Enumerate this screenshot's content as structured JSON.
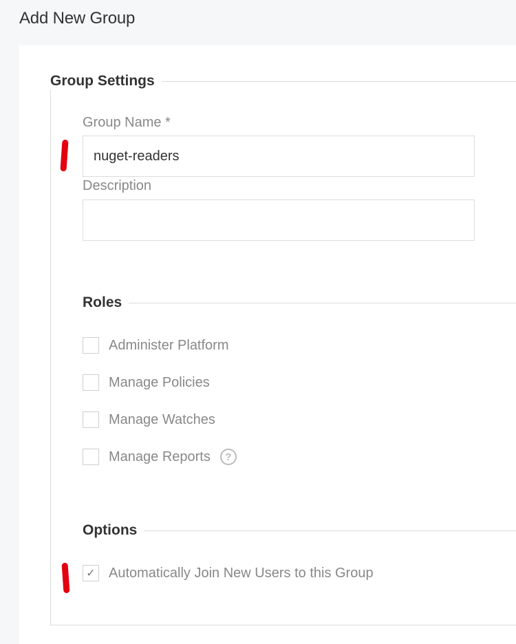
{
  "page": {
    "title": "Add New Group"
  },
  "group_settings": {
    "legend": "Group Settings",
    "group_name": {
      "label": "Group Name *",
      "value": "nuget-readers"
    },
    "description": {
      "label": "Description",
      "value": ""
    }
  },
  "roles": {
    "legend": "Roles",
    "items": [
      {
        "label": "Administer Platform",
        "checked": false
      },
      {
        "label": "Manage Policies",
        "checked": false
      },
      {
        "label": "Manage Watches",
        "checked": false
      },
      {
        "label": "Manage Reports",
        "checked": false,
        "help": "?"
      }
    ]
  },
  "options": {
    "legend": "Options",
    "items": [
      {
        "label": "Automatically Join New Users to this Group",
        "checked": true,
        "mark": "✓"
      }
    ]
  },
  "colors": {
    "annotation": "#e3000f",
    "border": "#dcdcdc",
    "background": "#f6f7f9"
  }
}
